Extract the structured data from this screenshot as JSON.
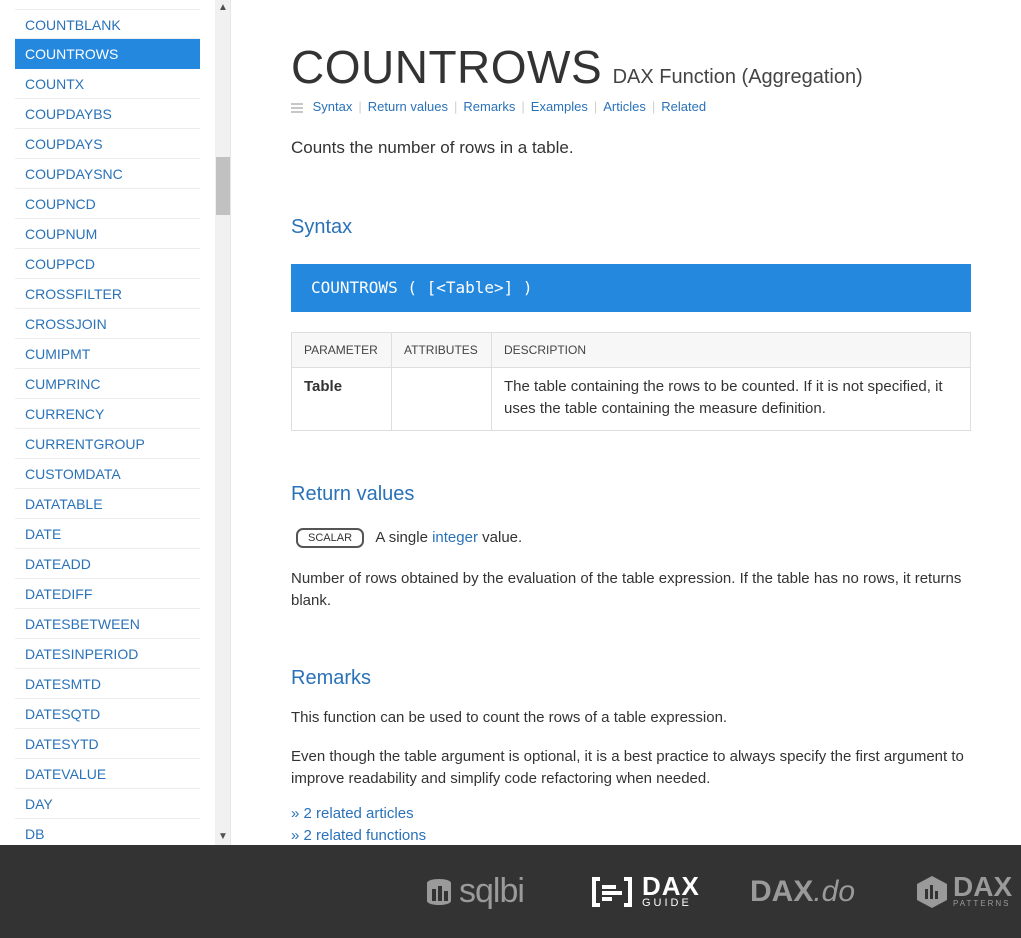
{
  "sidebar": {
    "items": [
      {
        "label": "COUNTBLANK",
        "active": false
      },
      {
        "label": "COUNTROWS",
        "active": true
      },
      {
        "label": "COUNTX",
        "active": false
      },
      {
        "label": "COUPDAYBS",
        "active": false
      },
      {
        "label": "COUPDAYS",
        "active": false
      },
      {
        "label": "COUPDAYSNC",
        "active": false
      },
      {
        "label": "COUPNCD",
        "active": false
      },
      {
        "label": "COUPNUM",
        "active": false
      },
      {
        "label": "COUPPCD",
        "active": false
      },
      {
        "label": "CROSSFILTER",
        "active": false
      },
      {
        "label": "CROSSJOIN",
        "active": false
      },
      {
        "label": "CUMIPMT",
        "active": false
      },
      {
        "label": "CUMPRINC",
        "active": false
      },
      {
        "label": "CURRENCY",
        "active": false
      },
      {
        "label": "CURRENTGROUP",
        "active": false
      },
      {
        "label": "CUSTOMDATA",
        "active": false
      },
      {
        "label": "DATATABLE",
        "active": false
      },
      {
        "label": "DATE",
        "active": false
      },
      {
        "label": "DATEADD",
        "active": false
      },
      {
        "label": "DATEDIFF",
        "active": false
      },
      {
        "label": "DATESBETWEEN",
        "active": false
      },
      {
        "label": "DATESINPERIOD",
        "active": false
      },
      {
        "label": "DATESMTD",
        "active": false
      },
      {
        "label": "DATESQTD",
        "active": false
      },
      {
        "label": "DATESYTD",
        "active": false
      },
      {
        "label": "DATEVALUE",
        "active": false
      },
      {
        "label": "DAY",
        "active": false
      },
      {
        "label": "DB",
        "active": false
      }
    ]
  },
  "main": {
    "title": "COUNTROWS",
    "subtitle": "DAX Function (Aggregation)",
    "toc": [
      "Syntax",
      "Return values",
      "Remarks",
      "Examples",
      "Articles",
      "Related"
    ],
    "summary": "Counts the number of rows in a table.",
    "syntax": {
      "heading": "Syntax",
      "code": "COUNTROWS ( [<Table>] )",
      "table_headers": [
        "PARAMETER",
        "ATTRIBUTES",
        "DESCRIPTION"
      ],
      "rows": [
        {
          "parameter": "Table",
          "attributes": "",
          "description": "The table containing the rows to be counted. If it is not specified, it uses the table containing the measure definition."
        }
      ]
    },
    "return_values": {
      "heading": "Return values",
      "badge": "SCALAR",
      "prefix": "A single",
      "type_link": "integer",
      "suffix": "value.",
      "description": "Number of rows obtained by the evaluation of the table expression. If the table has no rows, it returns blank."
    },
    "remarks": {
      "heading": "Remarks",
      "paragraph1": "This function can be used to count the rows of a table expression.",
      "paragraph2": "Even though the table argument is optional, it is a best practice to always specify the first argument to improve readability and simplify code refactoring when needed.",
      "related_articles": "» 2 related articles",
      "related_functions": "» 2 related functions"
    }
  },
  "footer": {
    "logos": {
      "sqlbi": "sqlbi",
      "daxguide_big": "DAX",
      "daxguide_small": "GUIDE",
      "daxdo_main": "DAX",
      "daxdo_suffix": ".do",
      "daxpatterns_big": "DAX",
      "daxpatterns_small": "PATTERNS"
    }
  },
  "colors": {
    "accent": "#2488df",
    "link": "#2a72b8",
    "footer_bg": "#333333",
    "text": "#333333"
  },
  "icons": {
    "scroll_up": "chevron-up-icon",
    "scroll_down": "chevron-down-icon",
    "toc_menu": "menu-icon"
  }
}
